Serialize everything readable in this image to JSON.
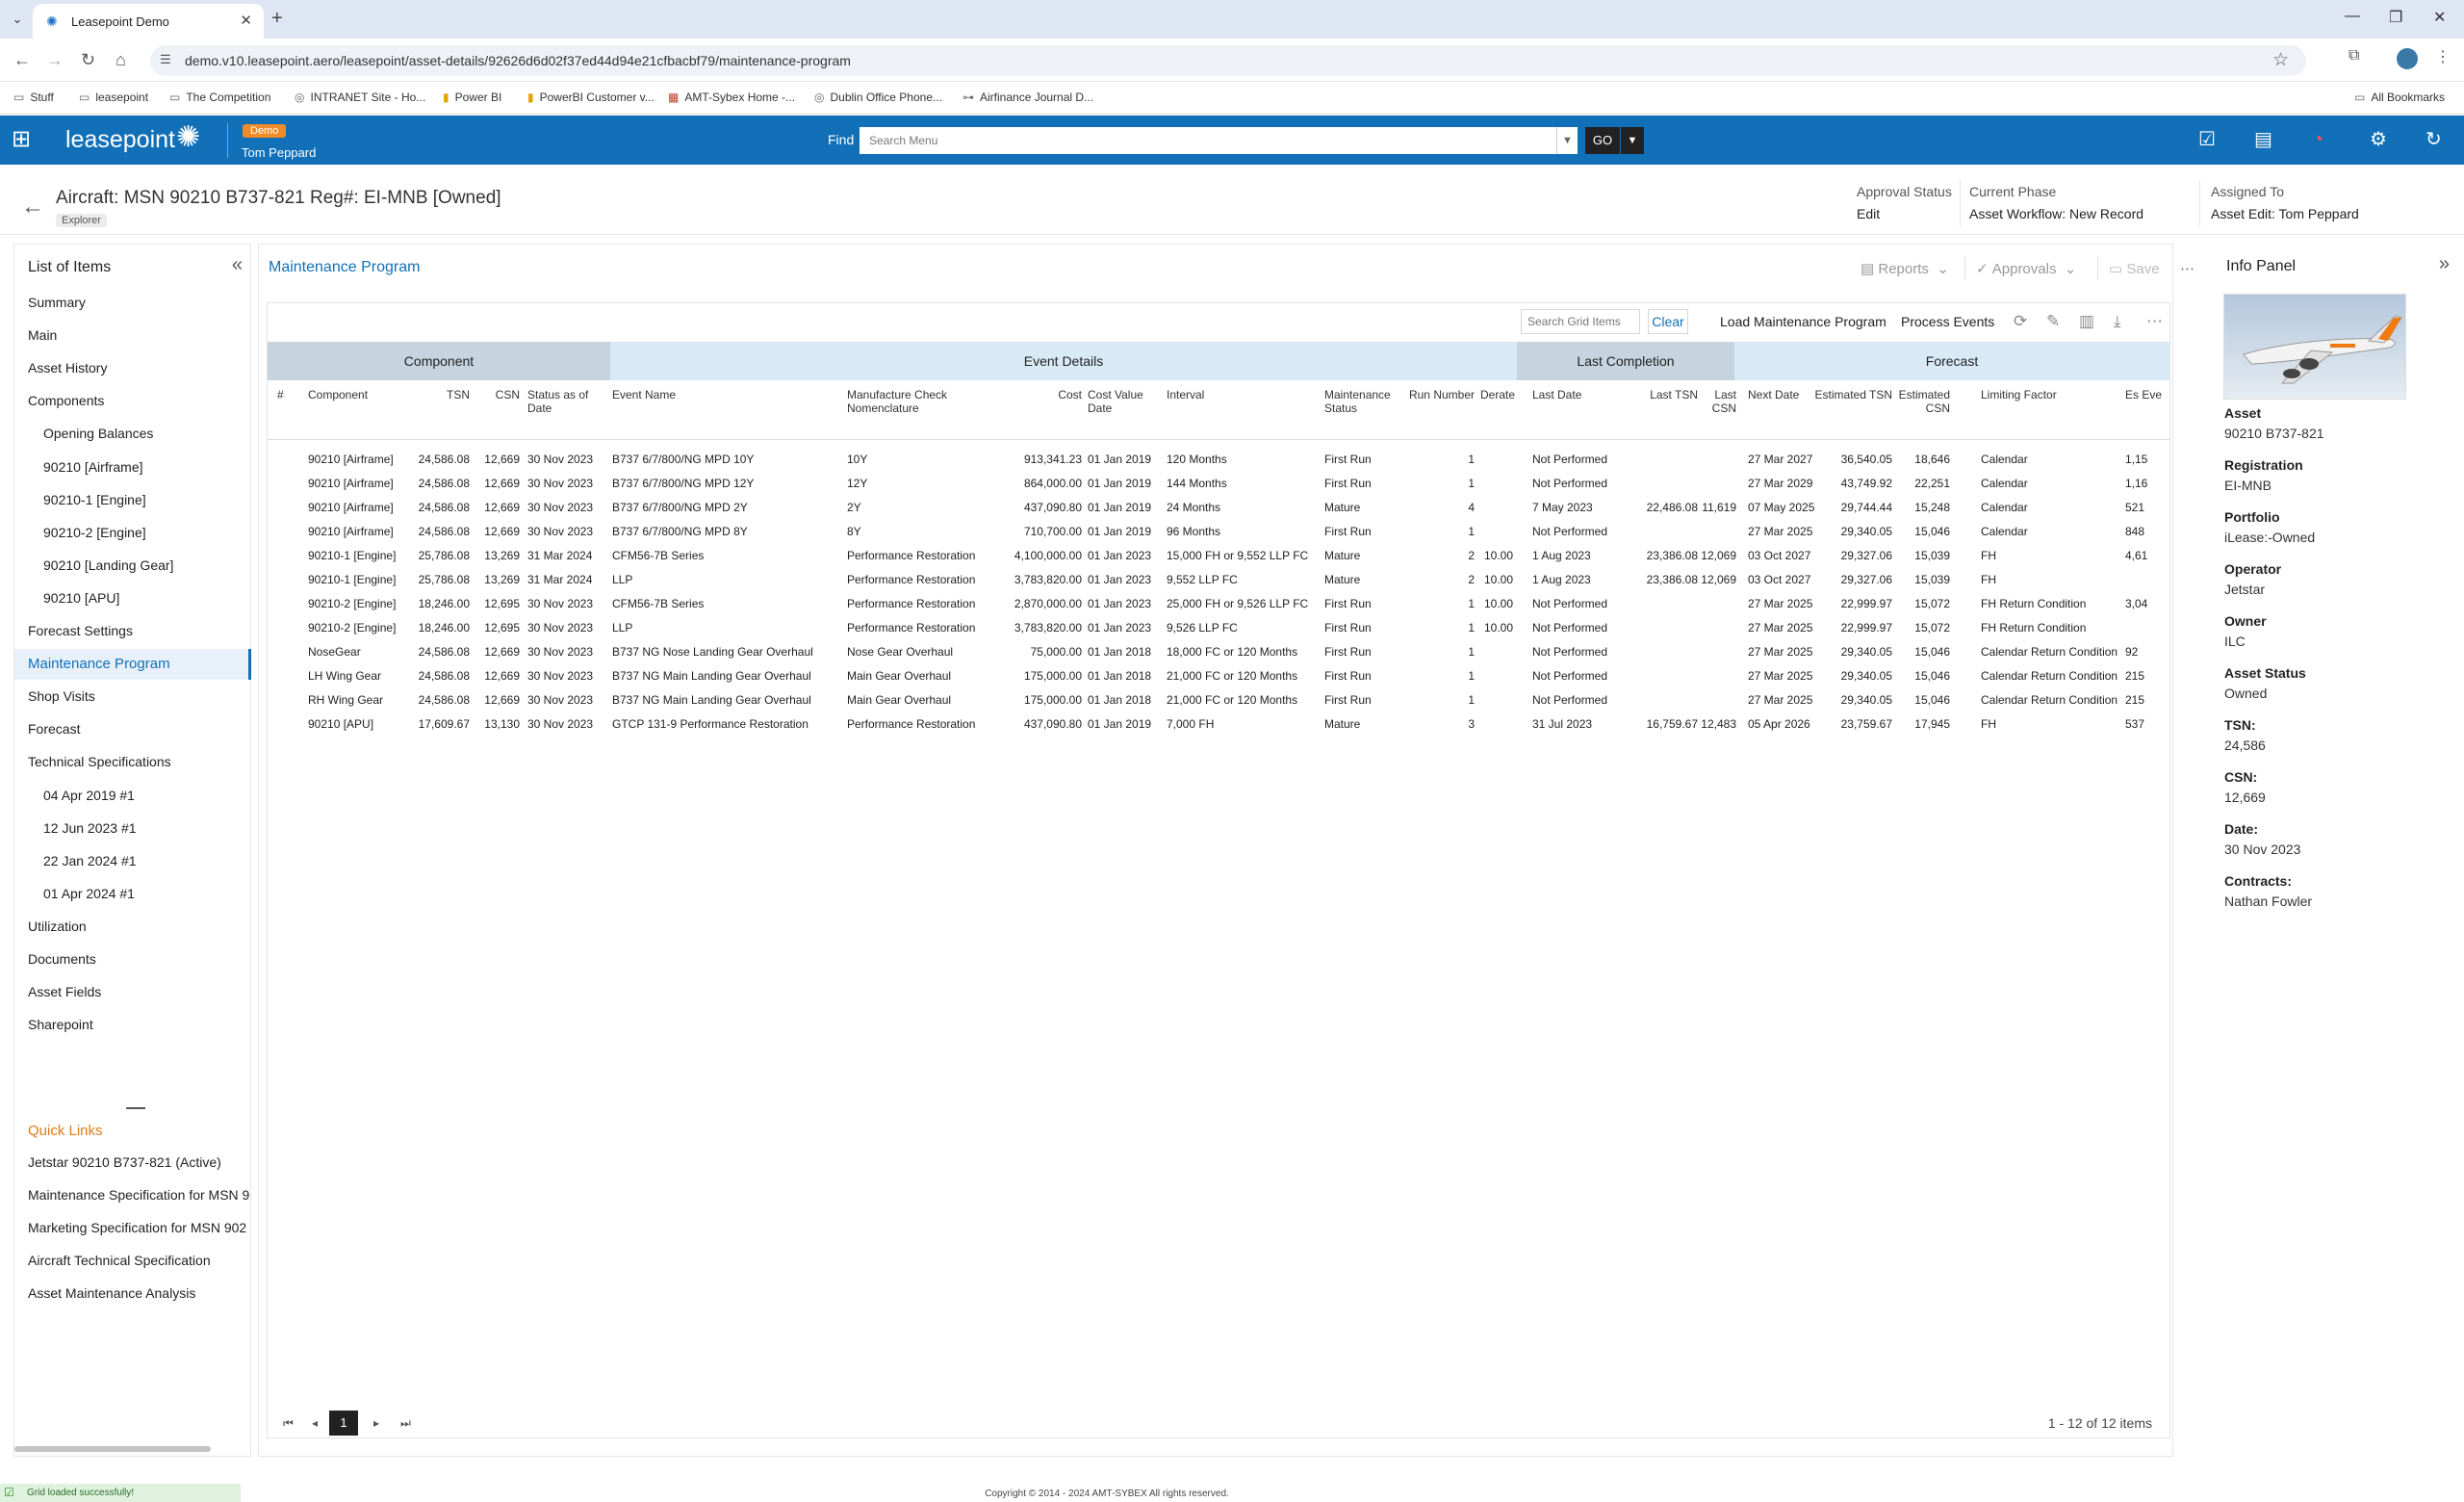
{
  "browser": {
    "tab_title": "Leasepoint Demo",
    "url": "demo.v10.leasepoint.aero/leasepoint/asset-details/92626d6d02f37ed44d94e21cfbacbf79/maintenance-program",
    "bookmarks": [
      "Stuff",
      "leasepoint",
      "The Competition",
      "INTRANET Site - Ho...",
      "Power BI",
      "PowerBI Customer v...",
      "AMT-Sybex Home -...",
      "Dublin Office Phone...",
      "Airfinance Journal D..."
    ],
    "all_bookmarks": "All Bookmarks"
  },
  "header": {
    "logo": "leasepoint",
    "env_badge": "Demo",
    "user": "Tom Peppard",
    "find_label": "Find",
    "find_placeholder": "Search Menu",
    "go_label": "GO"
  },
  "asset": {
    "title": "Aircraft: MSN 90210 B737-821 Reg#: EI-MNB [Owned]",
    "chip": "Explorer",
    "approval_status_label": "Approval Status",
    "approval_status": "Edit",
    "current_phase_label": "Current Phase",
    "current_phase": "Asset Workflow: New Record",
    "assigned_to_label": "Assigned To",
    "assigned_to": "Asset Edit: Tom Peppard"
  },
  "left_panel": {
    "title": "List of Items",
    "items": [
      {
        "label": "Summary",
        "level": 0
      },
      {
        "label": "Main",
        "level": 0
      },
      {
        "label": "Asset History",
        "level": 0
      },
      {
        "label": "Components",
        "level": 0
      },
      {
        "label": "Opening Balances",
        "level": 1
      },
      {
        "label": "90210 [Airframe]",
        "level": 1
      },
      {
        "label": "90210-1 [Engine]",
        "level": 1
      },
      {
        "label": "90210-2 [Engine]",
        "level": 1
      },
      {
        "label": "90210 [Landing Gear]",
        "level": 1
      },
      {
        "label": "90210 [APU]",
        "level": 1
      },
      {
        "label": "Forecast Settings",
        "level": 0
      },
      {
        "label": "Maintenance Program",
        "level": 0
      },
      {
        "label": "Shop Visits",
        "level": 0
      },
      {
        "label": "Forecast",
        "level": 0
      },
      {
        "label": "Technical Specifications",
        "level": 0
      },
      {
        "label": "04 Apr 2019 #1",
        "level": 1
      },
      {
        "label": "12 Jun 2023 #1",
        "level": 1
      },
      {
        "label": "22 Jan 2024 #1",
        "level": 1
      },
      {
        "label": "01 Apr 2024 #1",
        "level": 1
      },
      {
        "label": "Utilization",
        "level": 0
      },
      {
        "label": "Documents",
        "level": 0
      },
      {
        "label": "Asset Fields",
        "level": 0
      },
      {
        "label": "Sharepoint",
        "level": 0
      }
    ],
    "quick_links_title": "Quick Links",
    "quick_links": [
      "Jetstar 90210 B737-821 (Active)",
      "Maintenance Specification for MSN 9",
      "Marketing Specification for MSN 902",
      "Aircraft Technical Specification",
      "Asset Maintenance Analysis"
    ]
  },
  "main": {
    "title": "Maintenance Program",
    "reports": "Reports",
    "approvals": "Approvals",
    "save": "Save",
    "search_placeholder": "Search Grid Items",
    "clear": "Clear",
    "load_mp": "Load Maintenance Program",
    "process_events": "Process Events",
    "groups": [
      "Component",
      "Event Details",
      "Last Completion",
      "Forecast"
    ],
    "columns": [
      "#",
      "Component",
      "TSN",
      "CSN",
      "Status as of Date",
      "Event Name",
      "Manufacture Check Nomenclature",
      "Cost",
      "Cost Value Date",
      "Interval",
      "Maintenance Status",
      "Run Number",
      "Derate",
      "Last Date",
      "Last TSN",
      "Last CSN",
      "Next Date",
      "Estimated TSN",
      "Estimated CSN",
      "Limiting Factor",
      "Es Eve"
    ],
    "rows": [
      [
        "",
        "90210 [Airframe]",
        "24,586.08",
        "12,669",
        "30 Nov 2023",
        "B737 6/7/800/NG MPD 10Y",
        "10Y",
        "913,341.23",
        "01 Jan 2019",
        "120 Months",
        "First Run",
        "1",
        "",
        "Not Performed",
        "",
        "",
        "27 Mar 2027",
        "36,540.05",
        "18,646",
        "Calendar",
        "1,15"
      ],
      [
        "",
        "90210 [Airframe]",
        "24,586.08",
        "12,669",
        "30 Nov 2023",
        "B737 6/7/800/NG MPD 12Y",
        "12Y",
        "864,000.00",
        "01 Jan 2019",
        "144 Months",
        "First Run",
        "1",
        "",
        "Not Performed",
        "",
        "",
        "27 Mar 2029",
        "43,749.92",
        "22,251",
        "Calendar",
        "1,16"
      ],
      [
        "",
        "90210 [Airframe]",
        "24,586.08",
        "12,669",
        "30 Nov 2023",
        "B737 6/7/800/NG MPD 2Y",
        "2Y",
        "437,090.80",
        "01 Jan 2019",
        "24 Months",
        "Mature",
        "4",
        "",
        "7 May 2023",
        "22,486.08",
        "11,619",
        "07 May 2025",
        "29,744.44",
        "15,248",
        "Calendar",
        "521"
      ],
      [
        "",
        "90210 [Airframe]",
        "24,586.08",
        "12,669",
        "30 Nov 2023",
        "B737 6/7/800/NG MPD 8Y",
        "8Y",
        "710,700.00",
        "01 Jan 2019",
        "96 Months",
        "First Run",
        "1",
        "",
        "Not Performed",
        "",
        "",
        "27 Mar 2025",
        "29,340.05",
        "15,046",
        "Calendar",
        "848"
      ],
      [
        "",
        "90210-1 [Engine]",
        "25,786.08",
        "13,269",
        "31 Mar 2024",
        "CFM56-7B Series",
        "Performance Restoration",
        "4,100,000.00",
        "01 Jan 2023",
        "15,000 FH or 9,552 LLP FC",
        "Mature",
        "2",
        "10.00",
        "1 Aug 2023",
        "23,386.08",
        "12,069",
        "03 Oct 2027",
        "29,327.06",
        "15,039",
        "FH",
        "4,61"
      ],
      [
        "",
        "90210-1 [Engine]",
        "25,786.08",
        "13,269",
        "31 Mar 2024",
        "LLP",
        "Performance Restoration",
        "3,783,820.00",
        "01 Jan 2023",
        "9,552 LLP FC",
        "Mature",
        "2",
        "10.00",
        "1 Aug 2023",
        "23,386.08",
        "12,069",
        "03 Oct 2027",
        "29,327.06",
        "15,039",
        "FH",
        ""
      ],
      [
        "",
        "90210-2 [Engine]",
        "18,246.00",
        "12,695",
        "30 Nov 2023",
        "CFM56-7B Series",
        "Performance Restoration",
        "2,870,000.00",
        "01 Jan 2023",
        "25,000 FH or 9,526 LLP FC",
        "First Run",
        "1",
        "10.00",
        "Not Performed",
        "",
        "",
        "27 Mar 2025",
        "22,999.97",
        "15,072",
        "FH Return Condition",
        "3,04"
      ],
      [
        "",
        "90210-2 [Engine]",
        "18,246.00",
        "12,695",
        "30 Nov 2023",
        "LLP",
        "Performance Restoration",
        "3,783,820.00",
        "01 Jan 2023",
        "9,526 LLP FC",
        "First Run",
        "1",
        "10.00",
        "Not Performed",
        "",
        "",
        "27 Mar 2025",
        "22,999.97",
        "15,072",
        "FH Return Condition",
        ""
      ],
      [
        "",
        "NoseGear",
        "24,586.08",
        "12,669",
        "30 Nov 2023",
        "B737 NG Nose Landing Gear Overhaul",
        "Nose Gear Overhaul",
        "75,000.00",
        "01 Jan 2018",
        "18,000 FC or 120 Months",
        "First Run",
        "1",
        "",
        "Not Performed",
        "",
        "",
        "27 Mar 2025",
        "29,340.05",
        "15,046",
        "Calendar Return Condition",
        "92"
      ],
      [
        "",
        "LH Wing Gear",
        "24,586.08",
        "12,669",
        "30 Nov 2023",
        "B737 NG Main Landing Gear Overhaul",
        "Main Gear Overhaul",
        "175,000.00",
        "01 Jan 2018",
        "21,000 FC or 120 Months",
        "First Run",
        "1",
        "",
        "Not Performed",
        "",
        "",
        "27 Mar 2025",
        "29,340.05",
        "15,046",
        "Calendar Return Condition",
        "215"
      ],
      [
        "",
        "RH Wing Gear",
        "24,586.08",
        "12,669",
        "30 Nov 2023",
        "B737 NG Main Landing Gear Overhaul",
        "Main Gear Overhaul",
        "175,000.00",
        "01 Jan 2018",
        "21,000 FC or 120 Months",
        "First Run",
        "1",
        "",
        "Not Performed",
        "",
        "",
        "27 Mar 2025",
        "29,340.05",
        "15,046",
        "Calendar Return Condition",
        "215"
      ],
      [
        "",
        "90210 [APU]",
        "17,609.67",
        "13,130",
        "30 Nov 2023",
        "GTCP 131-9 Performance Restoration",
        "Performance Restoration",
        "437,090.80",
        "01 Jan 2019",
        "7,000 FH",
        "Mature",
        "3",
        "",
        "31 Jul 2023",
        "16,759.67",
        "12,483",
        "05 Apr 2026",
        "23,759.67",
        "17,945",
        "FH",
        "537"
      ]
    ],
    "page": "1",
    "page_info": "1 - 12 of 12 items"
  },
  "info_panel": {
    "title": "Info Panel",
    "fields": [
      {
        "label": "Asset",
        "value": "90210 B737-821"
      },
      {
        "label": "Registration",
        "value": "EI-MNB"
      },
      {
        "label": "Portfolio",
        "value": "iLease:-Owned"
      },
      {
        "label": "Operator",
        "value": "Jetstar"
      },
      {
        "label": "Owner",
        "value": "ILC"
      },
      {
        "label": "Asset Status",
        "value": "Owned"
      },
      {
        "label": "TSN:",
        "value": "24,586"
      },
      {
        "label": "CSN:",
        "value": "12,669"
      },
      {
        "label": "Date:",
        "value": "30 Nov 2023"
      },
      {
        "label": "Contracts:",
        "value": "Nathan Fowler"
      }
    ]
  },
  "footer": {
    "toast": "Grid loaded successfully!",
    "copyright": "Copyright © 2014 - 2024 AMT-SYBEX All rights reserved."
  },
  "colors": {
    "brand_blue": "#1170b8",
    "quick_links_orange": "#e07c1a",
    "group_component": "#c6d4e0",
    "group_event": "#d9eaf7",
    "group_last": "#c6d4e0",
    "group_forecast": "#d9eaf7"
  }
}
